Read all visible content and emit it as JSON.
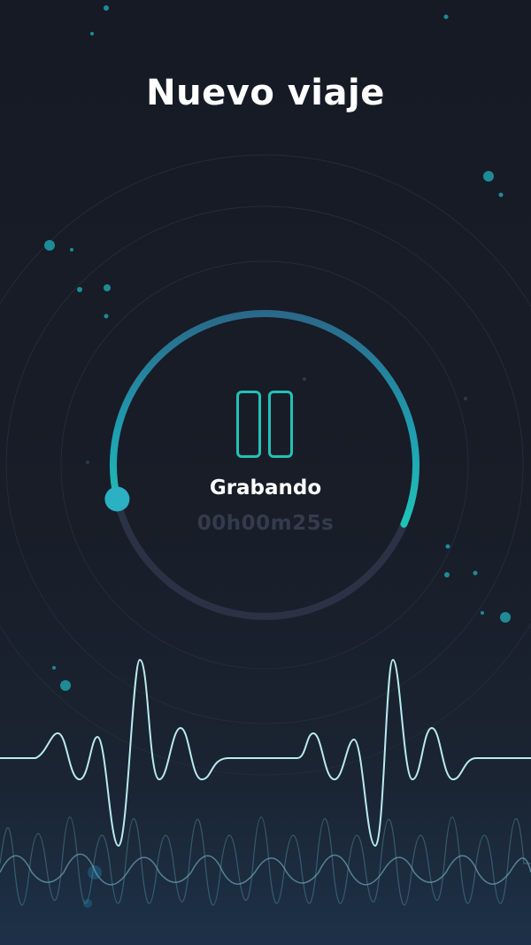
{
  "header": {
    "title": "Nuevo viaje"
  },
  "recorder": {
    "status_label": "Grabando",
    "elapsed_time": "00h00m25s",
    "progress_fraction": 0.6,
    "controls": {
      "pause_icon": "pause-icon"
    }
  },
  "colors": {
    "background": "#161a24",
    "accent": "#22c1b6",
    "accent_dark": "#2a6f8e",
    "track": "#2c3246",
    "timer_text": "#343b4c",
    "wave_primary": "#b8ebef",
    "wave_secondary": "#6fa6b6"
  }
}
